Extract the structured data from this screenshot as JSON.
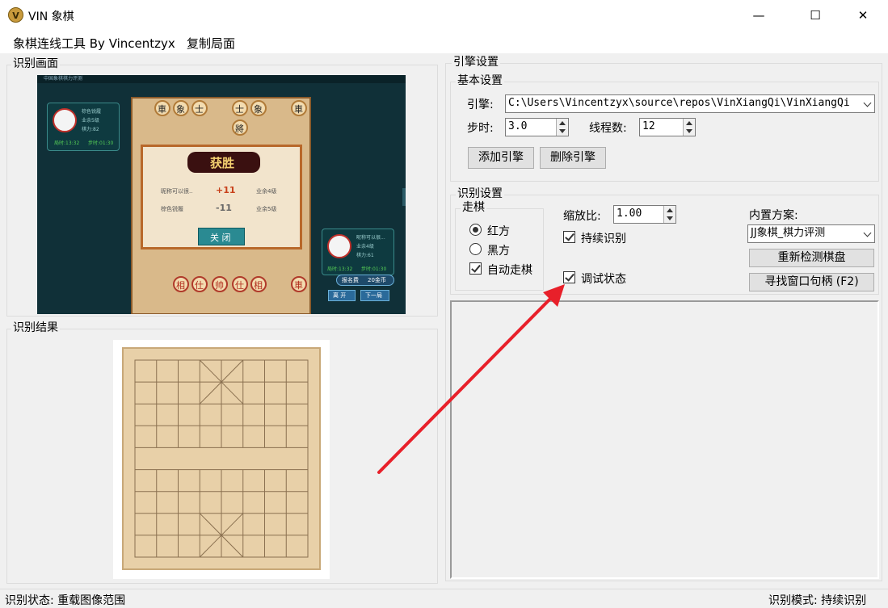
{
  "window": {
    "title": "VIN 象棋",
    "minimize": "—",
    "maximize": "☐",
    "close": "✕"
  },
  "menu": {
    "items": [
      "象棋连线工具 By Vincentzyx",
      "复制局面"
    ]
  },
  "recognition_screen": {
    "label": "识别画面"
  },
  "recognition_result": {
    "label": "识别结果"
  },
  "engine_settings": {
    "label": "引擎设置",
    "basic": {
      "label": "基本设置",
      "engine_label": "引擎:",
      "engine_path": "C:\\Users\\Vincentzyx\\source\\repos\\VinXiangQi\\VinXiangQi",
      "step_time_label": "步时:",
      "step_time": "3.0",
      "threads_label": "线程数:",
      "threads": "12",
      "add_engine": "添加引擎",
      "remove_engine": "删除引擎"
    }
  },
  "recognition_settings": {
    "label": "识别设置",
    "move_group_label": "走棋",
    "red_side": "红方",
    "black_side": "黑方",
    "auto_move": "自动走棋",
    "scale_label": "缩放比:",
    "scale": "1.00",
    "continuous": "持续识别",
    "debug": "调试状态",
    "preset_label": "内置方案:",
    "preset_value": "JJ象棋_棋力评测",
    "redetect_board": "重新检测棋盘",
    "find_handle": "寻找窗口句柄 (F2)"
  },
  "state": {
    "red_side_selected": true,
    "black_side_selected": false,
    "auto_move_checked": true,
    "continuous_checked": true,
    "debug_checked": true
  },
  "status": {
    "left": "识别状态: 重载图像范围",
    "right": "识别模式: 持续识别"
  },
  "game_capture": {
    "window_title": "中国象棋棋力评测",
    "result_title": "获胜",
    "player1_name": "棕色锐履",
    "player1_level": "业余5级",
    "player1_power": "棋力:82",
    "player1_timer": "局时:13:32",
    "player1_step": "步时:01:30",
    "player2_name": "昵称可以很...",
    "player2_level": "业余4级",
    "player2_power": "棋力:61",
    "player2_timer": "局时:13:32",
    "player2_step": "步时:01:30",
    "row1_name": "昵称可以很..",
    "row1_delta": "+11",
    "row1_level": "业余4级",
    "row2_name": "棕色锐履",
    "row2_delta": "-11",
    "row2_level": "业余5级",
    "close_btn": "关 闭",
    "signup": "报名费",
    "fee": "20金币",
    "btn_leave": "离 开",
    "btn_next": "下一局",
    "top_pieces": [
      "車",
      "象",
      "士",
      "士",
      "象",
      "車"
    ],
    "general": "將",
    "bottom_pieces": [
      "相",
      "仕",
      "帅",
      "仕",
      "相",
      "車"
    ]
  },
  "colors": {
    "arrow": "#e8202a"
  }
}
